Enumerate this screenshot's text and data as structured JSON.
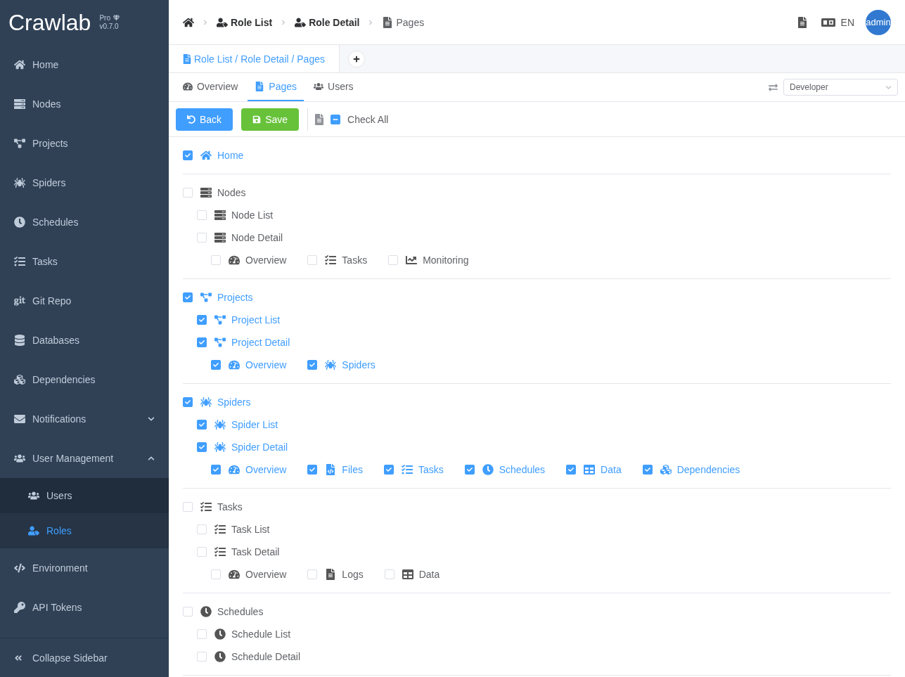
{
  "logo": {
    "name": "Crawlab",
    "edition": "Pro",
    "version": "v0.7.0"
  },
  "sidebar": {
    "items": [
      {
        "kind": "home",
        "label": "Home",
        "selected": false
      },
      {
        "kind": "nodes",
        "label": "Nodes",
        "selected": false
      },
      {
        "kind": "projects",
        "label": "Projects",
        "selected": false
      },
      {
        "kind": "spiders",
        "label": "Spiders",
        "selected": false
      },
      {
        "kind": "schedules",
        "label": "Schedules",
        "selected": false
      },
      {
        "kind": "tasks",
        "label": "Tasks",
        "selected": false
      },
      {
        "kind": "git",
        "label": "Git Repo",
        "selected": false
      },
      {
        "kind": "databases",
        "label": "Databases",
        "selected": false
      },
      {
        "kind": "dependencies",
        "label": "Dependencies",
        "selected": false
      },
      {
        "kind": "notifications",
        "label": "Notifications",
        "selected": false,
        "expanded": false
      },
      {
        "kind": "users",
        "label": "User Management",
        "selected": false,
        "expanded": true,
        "children": [
          {
            "kind": "users",
            "label": "Users",
            "selected": false
          },
          {
            "kind": "roles",
            "label": "Roles",
            "selected": true
          }
        ]
      },
      {
        "kind": "environment",
        "label": "Environment",
        "selected": false
      },
      {
        "kind": "tokens",
        "label": "API Tokens",
        "selected": false
      }
    ],
    "collapse": "Collapse Sidebar"
  },
  "breadcrumbs": [
    {
      "kind": "home"
    },
    {
      "kind": "roles",
      "label": "Role List"
    },
    {
      "kind": "roles",
      "label": "Role Detail"
    },
    {
      "kind": "page",
      "label": "Pages"
    }
  ],
  "header": {
    "language": "EN",
    "user": "admin"
  },
  "open_tabs": [
    {
      "label": "Role List / Role Detail / Pages",
      "selected": true
    }
  ],
  "detail_tabs": [
    {
      "kind": "overview",
      "label": "Overview",
      "selected": false
    },
    {
      "kind": "page",
      "label": "Pages",
      "selected": true
    },
    {
      "kind": "users",
      "label": "Users",
      "selected": false
    }
  ],
  "role_select": {
    "value": "Developer"
  },
  "toolbar": {
    "back": "Back",
    "save": "Save",
    "check_all": {
      "label": "Check All",
      "indeterminate": true
    }
  },
  "sections": [
    {
      "kind": "home",
      "label": "Home",
      "checked": true
    },
    {
      "kind": "nodes",
      "label": "Nodes",
      "checked": false,
      "children": [
        {
          "kind": "nodes",
          "label": "Node List",
          "checked": false
        },
        {
          "kind": "nodes",
          "label": "Node Detail",
          "checked": false,
          "tabs": [
            {
              "kind": "overview",
              "label": "Overview",
              "checked": false
            },
            {
              "kind": "tasks",
              "label": "Tasks",
              "checked": false
            },
            {
              "kind": "monitoring",
              "label": "Monitoring",
              "checked": false
            }
          ]
        }
      ]
    },
    {
      "kind": "projects",
      "label": "Projects",
      "checked": true,
      "children": [
        {
          "kind": "projects",
          "label": "Project List",
          "checked": true
        },
        {
          "kind": "projects",
          "label": "Project Detail",
          "checked": true,
          "tabs": [
            {
              "kind": "overview",
              "label": "Overview",
              "checked": true
            },
            {
              "kind": "spiders",
              "label": "Spiders",
              "checked": true
            }
          ]
        }
      ]
    },
    {
      "kind": "spiders",
      "label": "Spiders",
      "checked": true,
      "children": [
        {
          "kind": "spiders",
          "label": "Spider List",
          "checked": true
        },
        {
          "kind": "spiders",
          "label": "Spider Detail",
          "checked": true,
          "tabs": [
            {
              "kind": "overview",
              "label": "Overview",
              "checked": true
            },
            {
              "kind": "files",
              "label": "Files",
              "checked": true
            },
            {
              "kind": "tasks",
              "label": "Tasks",
              "checked": true
            },
            {
              "kind": "schedules",
              "label": "Schedules",
              "checked": true
            },
            {
              "kind": "data",
              "label": "Data",
              "checked": true
            },
            {
              "kind": "dependencies",
              "label": "Dependencies",
              "checked": true
            }
          ]
        }
      ]
    },
    {
      "kind": "tasks",
      "label": "Tasks",
      "checked": false,
      "children": [
        {
          "kind": "tasks",
          "label": "Task List",
          "checked": false
        },
        {
          "kind": "tasks",
          "label": "Task Detail",
          "checked": false,
          "tabs": [
            {
              "kind": "overview",
              "label": "Overview",
              "checked": false
            },
            {
              "kind": "logs",
              "label": "Logs",
              "checked": false
            },
            {
              "kind": "data",
              "label": "Data",
              "checked": false
            }
          ]
        }
      ]
    },
    {
      "kind": "schedules",
      "label": "Schedules",
      "checked": false,
      "children": [
        {
          "kind": "schedules",
          "label": "Schedule List",
          "checked": false
        },
        {
          "kind": "schedules",
          "label": "Schedule Detail",
          "checked": false
        }
      ]
    }
  ]
}
